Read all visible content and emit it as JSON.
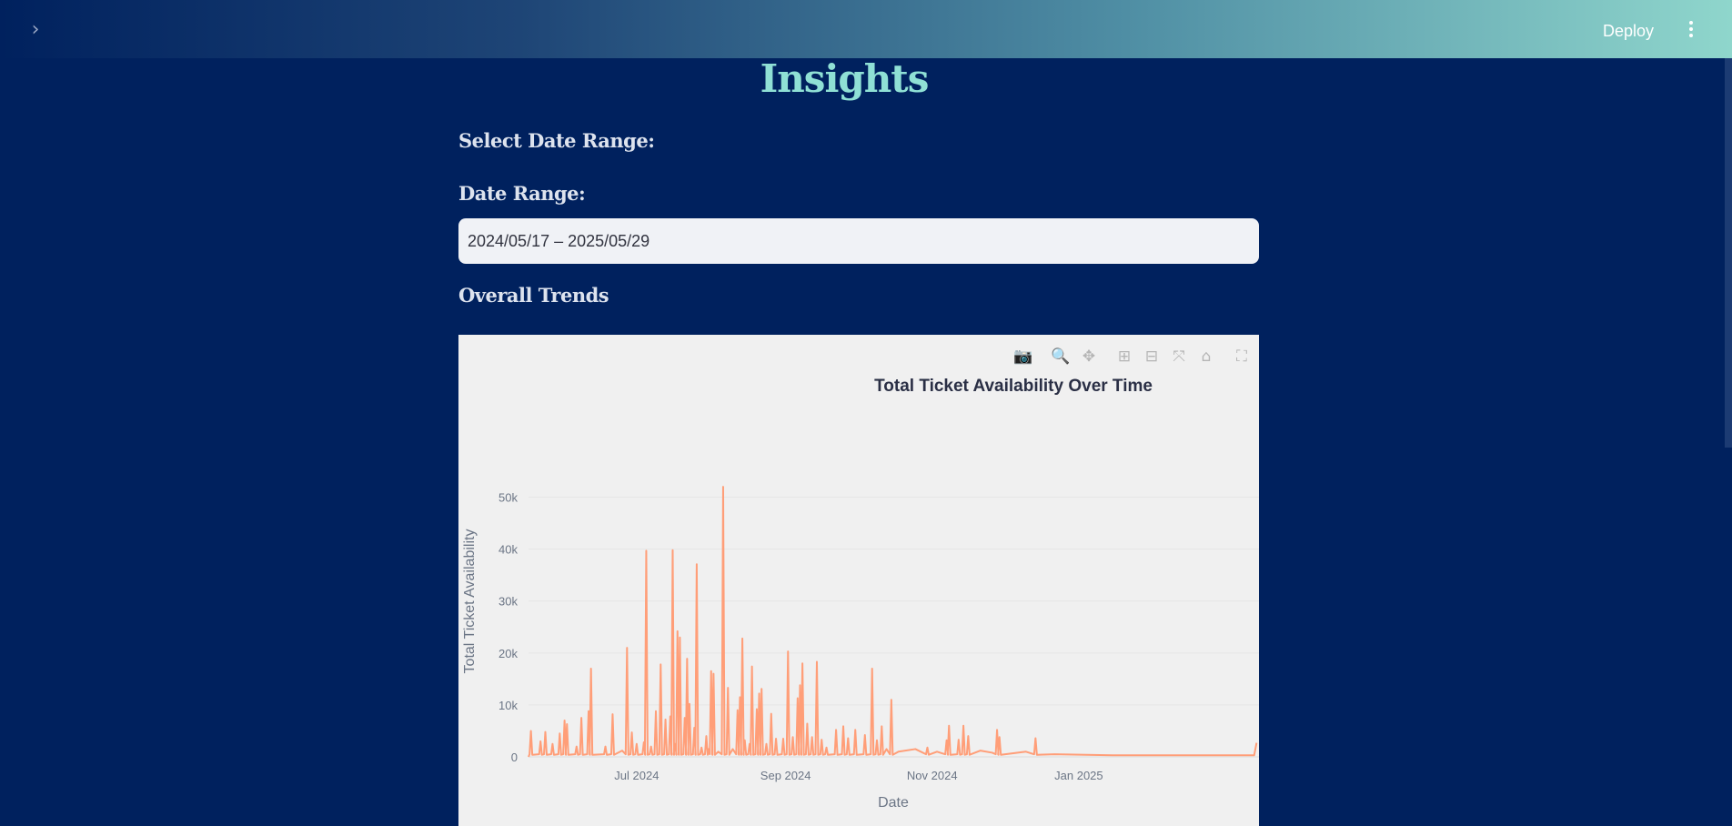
{
  "header": {
    "sidebar_toggle_icon": "chevron-right-icon",
    "deploy_label": "Deploy",
    "menu_icon": "kebab-menu-icon"
  },
  "page": {
    "title": "Insights",
    "select_range_label": "Select Date Range:",
    "date_range_label": "Date Range:",
    "date_range_value": "2024/05/17 – 2025/05/29",
    "overall_trends_label": "Overall Trends"
  },
  "modebar": {
    "icons": [
      "camera-icon",
      "zoom-icon",
      "pan-icon",
      "zoom-in-icon",
      "zoom-out-icon",
      "autoscale-icon",
      "reset-axes-icon",
      "fullscreen-icon"
    ],
    "active": "zoom-icon"
  },
  "colors": {
    "accent": "#8fe0d5",
    "background": "#00215e",
    "line": "#ff9e78"
  },
  "chart_data": {
    "type": "line",
    "title": "Total Ticket Availability Over Time",
    "xlabel": "Date",
    "ylabel": "Total Ticket Availability",
    "x_ticks": [
      "Jul 2024",
      "Sep 2024",
      "Nov 2024",
      "Jan 2025"
    ],
    "y_ticks": [
      "0",
      "10k",
      "20k",
      "30k",
      "40k",
      "50k"
    ],
    "ylim": [
      0,
      55000
    ],
    "xlim": [
      "2024-05-17",
      "2025-03-17"
    ],
    "grid": true,
    "series": [
      {
        "values": [
          [
            "2024-05-18",
            5000
          ],
          [
            "2024-05-22",
            3000
          ],
          [
            "2024-05-24",
            4800
          ],
          [
            "2024-05-27",
            2500
          ],
          [
            "2024-05-30",
            4500
          ],
          [
            "2024-06-01",
            7000
          ],
          [
            "2024-06-02",
            6300
          ],
          [
            "2024-06-06",
            2000
          ],
          [
            "2024-06-08",
            7500
          ],
          [
            "2024-06-11",
            8800
          ],
          [
            "2024-06-12",
            17000
          ],
          [
            "2024-06-18",
            2000
          ],
          [
            "2024-06-21",
            8200
          ],
          [
            "2024-06-25",
            1200
          ],
          [
            "2024-06-27",
            21000
          ],
          [
            "2024-06-29",
            4700
          ],
          [
            "2024-07-01",
            2500
          ],
          [
            "2024-07-04",
            2800
          ],
          [
            "2024-07-05",
            39700
          ],
          [
            "2024-07-07",
            2000
          ],
          [
            "2024-07-09",
            8800
          ],
          [
            "2024-07-11",
            17800
          ],
          [
            "2024-07-13",
            7200
          ],
          [
            "2024-07-15",
            7800
          ],
          [
            "2024-07-16",
            39800
          ],
          [
            "2024-07-17",
            2500
          ],
          [
            "2024-07-18",
            24200
          ],
          [
            "2024-07-19",
            23000
          ],
          [
            "2024-07-21",
            7500
          ],
          [
            "2024-07-22",
            18900
          ],
          [
            "2024-07-23",
            10200
          ],
          [
            "2024-07-25",
            5600
          ],
          [
            "2024-07-26",
            37100
          ],
          [
            "2024-07-28",
            1800
          ],
          [
            "2024-07-30",
            4000
          ],
          [
            "2024-07-31",
            1500
          ],
          [
            "2024-08-01",
            16500
          ],
          [
            "2024-08-02",
            16000
          ],
          [
            "2024-08-04",
            1000
          ],
          [
            "2024-08-06",
            52000
          ],
          [
            "2024-08-08",
            13300
          ],
          [
            "2024-08-10",
            1500
          ],
          [
            "2024-08-12",
            9000
          ],
          [
            "2024-08-13",
            11500
          ],
          [
            "2024-08-14",
            22800
          ],
          [
            "2024-08-15",
            3200
          ],
          [
            "2024-08-17",
            2500
          ],
          [
            "2024-08-18",
            17400
          ],
          [
            "2024-08-20",
            9200
          ],
          [
            "2024-08-21",
            12200
          ],
          [
            "2024-08-22",
            13100
          ],
          [
            "2024-08-24",
            2500
          ],
          [
            "2024-08-26",
            8300
          ],
          [
            "2024-08-28",
            3500
          ],
          [
            "2024-08-31",
            3500
          ],
          [
            "2024-09-02",
            20300
          ],
          [
            "2024-09-04",
            3800
          ],
          [
            "2024-09-06",
            11300
          ],
          [
            "2024-09-07",
            13800
          ],
          [
            "2024-09-08",
            18000
          ],
          [
            "2024-09-10",
            6400
          ],
          [
            "2024-09-12",
            3800
          ],
          [
            "2024-09-14",
            18300
          ],
          [
            "2024-09-16",
            3300
          ],
          [
            "2024-09-18",
            1800
          ],
          [
            "2024-09-22",
            5200
          ],
          [
            "2024-09-25",
            5900
          ],
          [
            "2024-09-27",
            3600
          ],
          [
            "2024-09-30",
            5200
          ],
          [
            "2024-10-04",
            4200
          ],
          [
            "2024-10-07",
            17000
          ],
          [
            "2024-10-09",
            3200
          ],
          [
            "2024-10-11",
            5900
          ],
          [
            "2024-10-13",
            1500
          ],
          [
            "2024-10-15",
            11000
          ],
          [
            "2024-10-18",
            1000
          ],
          [
            "2024-10-25",
            1500
          ],
          [
            "2024-10-30",
            1800
          ],
          [
            "2024-11-03",
            1000
          ],
          [
            "2024-11-07",
            3200
          ],
          [
            "2024-11-08",
            6000
          ],
          [
            "2024-11-12",
            3300
          ],
          [
            "2024-11-14",
            6000
          ],
          [
            "2024-11-16",
            4000
          ],
          [
            "2024-11-21",
            1200
          ],
          [
            "2024-11-26",
            800
          ],
          [
            "2024-11-28",
            5200
          ],
          [
            "2024-11-29",
            3800
          ],
          [
            "2024-12-10",
            1000
          ],
          [
            "2024-12-14",
            3600
          ],
          [
            "2024-12-22",
            500
          ],
          [
            "2025-01-15",
            300
          ],
          [
            "2025-02-10",
            300
          ],
          [
            "2025-03-15",
            300
          ],
          [
            "2025-03-16",
            2700
          ]
        ]
      }
    ]
  }
}
